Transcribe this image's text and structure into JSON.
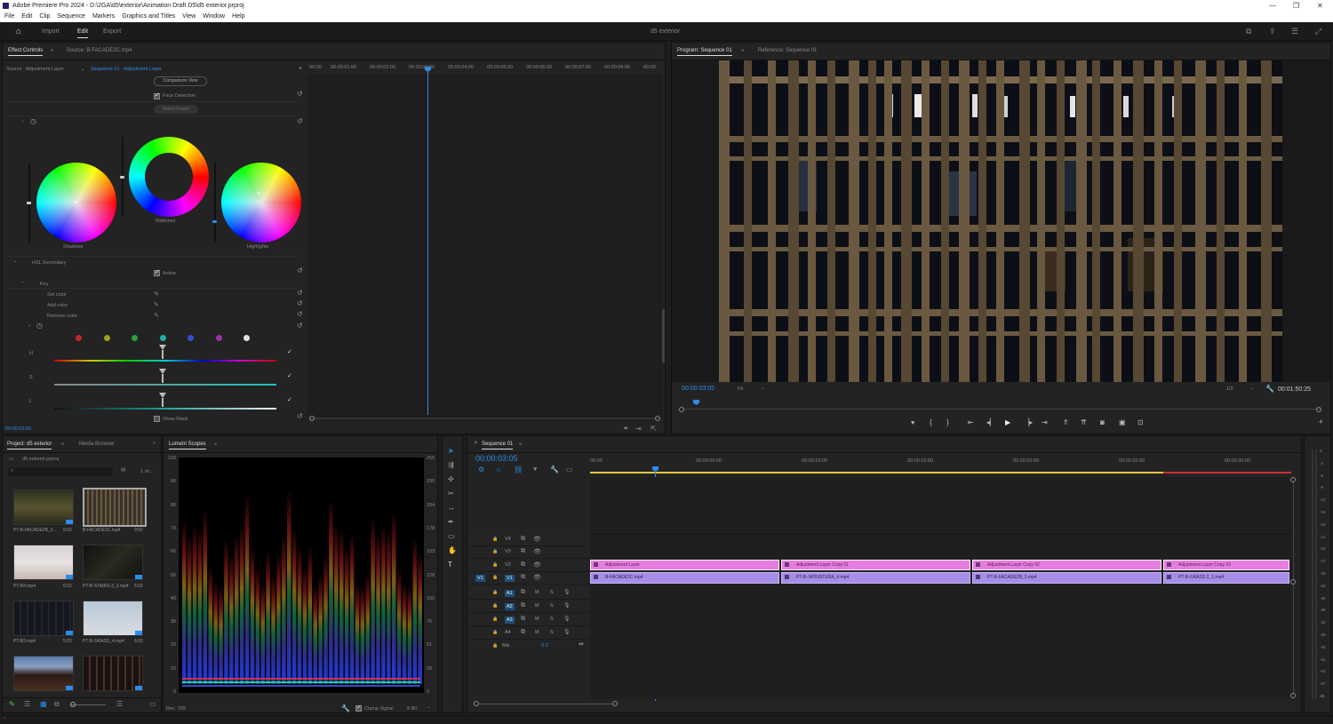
{
  "window": {
    "title": "Adobe Premiere Pro 2024 - D:\\2GA\\d5\\exterior\\Animation Draft D5\\d5 exterior.prproj",
    "controls": [
      "—",
      "❐",
      "✕"
    ]
  },
  "menu": [
    "File",
    "Edit",
    "Clip",
    "Sequence",
    "Markers",
    "Graphics and Titles",
    "View",
    "Window",
    "Help"
  ],
  "workspaces": {
    "tabs": [
      "Import",
      "Edit",
      "Export"
    ],
    "active": "Edit",
    "project_name": "d5 exterior"
  },
  "effect_controls": {
    "tabs": [
      "Effect Controls",
      "Source: B-FACADE2C.mp4"
    ],
    "source_label": "Source · Adjustment Layer",
    "sequence_label": "Sequence 01 · Adjustment Layer",
    "comparison_view": "Comparison View",
    "face_detection": "Face Detection",
    "match_button": "Match Frame",
    "wheels": [
      "Shadows",
      "Midtones",
      "Highlights"
    ],
    "hsl_secondary": "HSL Secondary",
    "active_label": "Active",
    "key_label": "Key",
    "set_color": "Set color",
    "add_color": "Add color",
    "remove_color": "Remove color",
    "hsl_rows": [
      "H",
      "S",
      "L"
    ],
    "show_mask": "Show Mask",
    "timecode": "00:00:03:05",
    "ruler": [
      "00:00",
      "00:00:01:00",
      "00:00:02:00",
      "00:00:03:00",
      "00:00:04:00",
      "00:00:05:00",
      "00:00:06:00",
      "00:00:07:00",
      "00:00:08:00",
      "00:00"
    ],
    "swatch_colors": [
      "#c0292b",
      "#a0a020",
      "#2aa040",
      "#20b0b0",
      "#3050d0",
      "#a030b0",
      "#e0e0e0"
    ]
  },
  "program_monitor": {
    "tabs": [
      "Program: Sequence 01",
      "Reference: Sequence 01"
    ],
    "timecode": "00:00:03:05",
    "fit": "Fit",
    "resolution": "1/2",
    "duration": "00:01:50:25"
  },
  "project": {
    "tabs": [
      "Project: d5 exterior",
      "Media Browser"
    ],
    "file": "d5 exterior.prproj",
    "count": "1 of...",
    "items": [
      {
        "name": "PT-B-FACADE2B_3...",
        "dur": "9:02"
      },
      {
        "name": "B-FACADE2C.mp4",
        "dur": "9:02"
      },
      {
        "name": "PT-B3.mp4",
        "dur": "6:02"
      },
      {
        "name": "PT-B-STAIRS-3_3.mp4",
        "dur": "6:02"
      },
      {
        "name": "PT-B3.mp4",
        "dur": "5:02"
      },
      {
        "name": "PT-B-GRASS_4.mp4",
        "dur": "6:02"
      },
      {
        "name": "",
        "dur": ""
      },
      {
        "name": "",
        "dur": ""
      }
    ]
  },
  "scopes": {
    "tab": "Lumetri Scopes",
    "left_ticks": [
      "100",
      "90",
      "80",
      "70",
      "60",
      "50",
      "40",
      "30",
      "20",
      "10",
      "0"
    ],
    "right_ticks": [
      "255",
      "230",
      "204",
      "178",
      "153",
      "128",
      "102",
      "76",
      "51",
      "26",
      "0"
    ],
    "colorspace": "Rec. 709",
    "clamp": "Clamp Signal",
    "bit": "8 Bit"
  },
  "timeline": {
    "tab": "Sequence 01",
    "timecode": "00:00:03:05",
    "ruler": [
      "00:00",
      "00:00:05:00",
      "00:00:10:00",
      "00:00:15:00",
      "00:00:20:00",
      "00:00:25:00",
      "00:00:30:00"
    ],
    "video_tracks": [
      "V4",
      "V3",
      "V2",
      "V1"
    ],
    "audio_tracks": [
      "A1",
      "A2",
      "A3",
      "A4"
    ],
    "mix": "Mix",
    "mix_value": "0.0",
    "v2_clips": [
      "Adjustment Layer",
      "Adjustment Layer Copy 01",
      "Adjustment Layer Copy 02",
      "Adjustment Layer Copy 03"
    ],
    "v1_clips": [
      "B-FACADE2C.mp4",
      "PT-B- MONSTERA_4.mp4",
      "PT-B-FACADE2B_3.mp4",
      "PT-B-GRASS 2_1.mp4"
    ],
    "meter_ticks": [
      "0",
      "-3",
      "-6",
      "-9",
      "-12",
      "-15",
      "-18",
      "-21",
      "-24",
      "-27",
      "-30",
      "-33",
      "-36",
      "-39",
      "-42",
      "-45",
      "-48",
      "-51",
      "-54",
      "-57",
      "dB"
    ]
  }
}
